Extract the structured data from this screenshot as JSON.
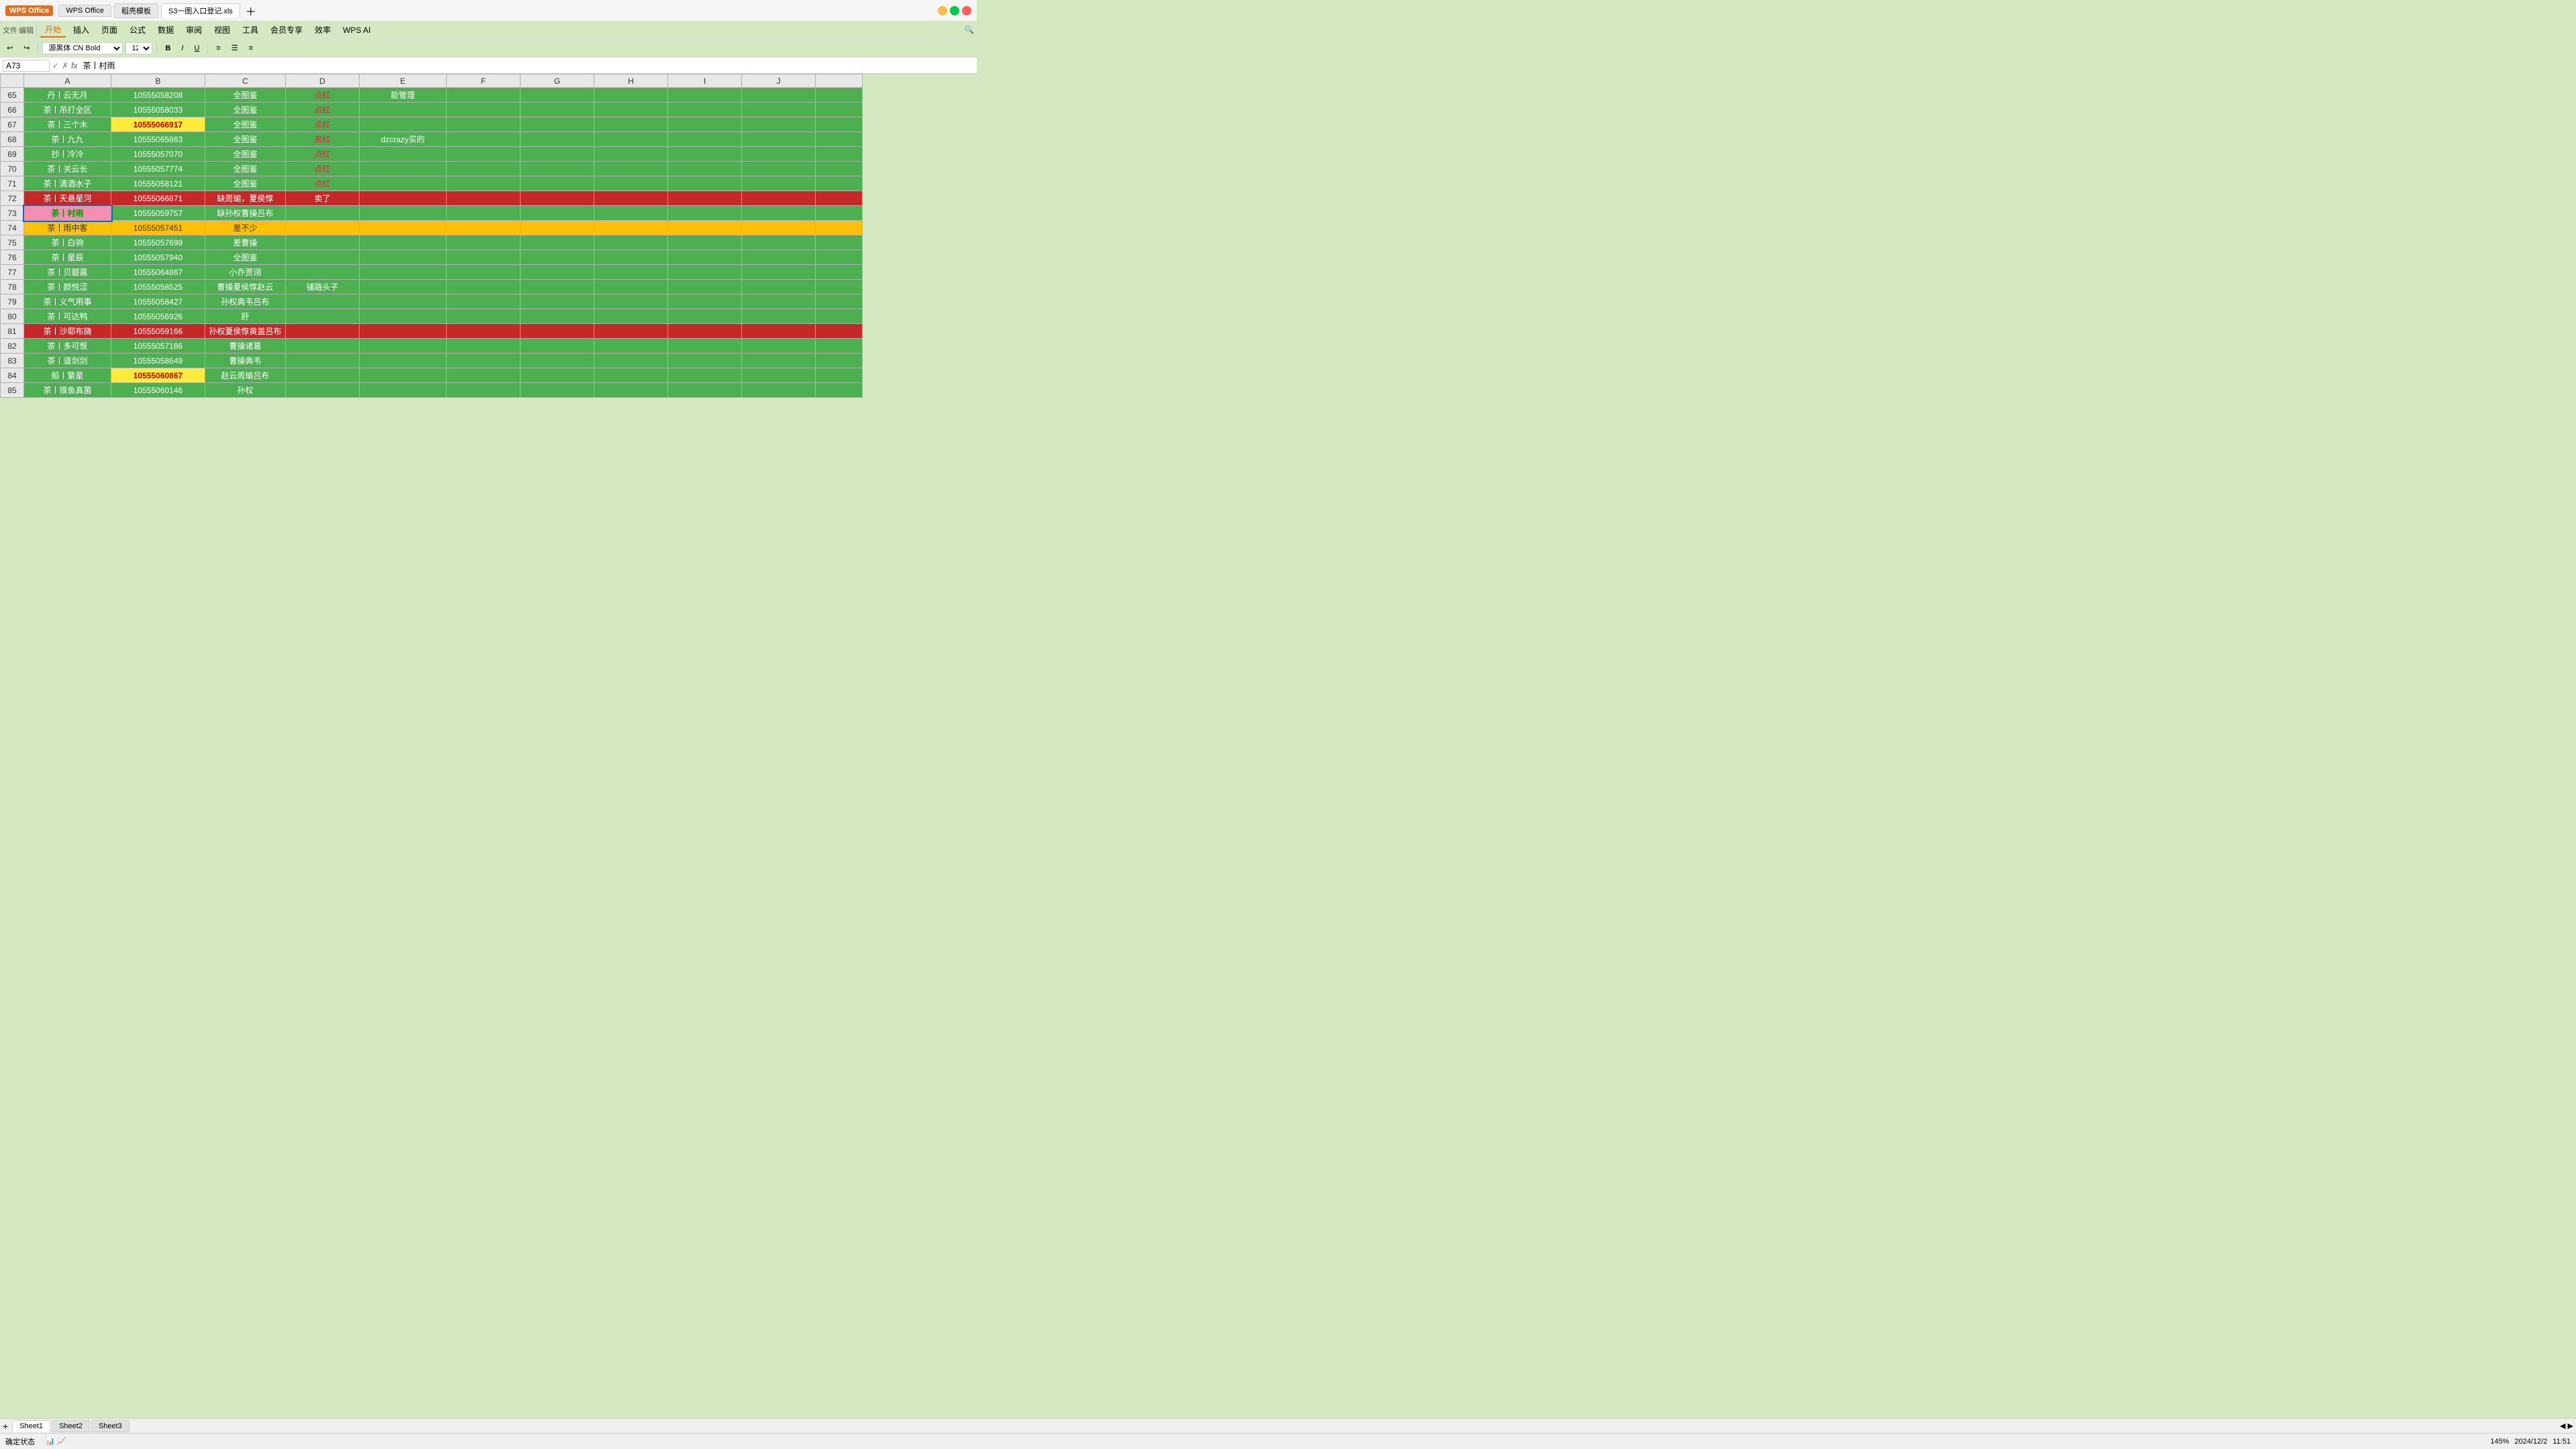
{
  "app": {
    "title": "S3一图入口登记.xls",
    "wps_label": "WPS Office",
    "template_label": "稻壳模板"
  },
  "tabs": [
    {
      "label": "WPS Office",
      "active": false
    },
    {
      "label": "稻壳模板",
      "active": false
    },
    {
      "label": "S3一图入口登记.xls",
      "active": true
    }
  ],
  "menu": {
    "items": [
      "开始",
      "插入",
      "页面",
      "公式",
      "数据",
      "审阅",
      "视图",
      "工具",
      "会员专享",
      "效率",
      "WPS AI"
    ]
  },
  "formula_bar": {
    "cell_ref": "A73",
    "value": "茶丨村雨"
  },
  "columns": {
    "headers": [
      "",
      "A",
      "B",
      "C",
      "D",
      "E",
      "F",
      "G",
      "H",
      "I",
      "J"
    ],
    "widths": [
      35,
      130,
      140,
      120,
      110,
      130,
      110,
      110,
      110,
      110,
      110
    ]
  },
  "rows": [
    {
      "num": 65,
      "color": "green",
      "cells": [
        "丹丨云无月",
        "10555058208",
        "全图鉴",
        "点红",
        "能管理",
        "",
        "",
        "",
        "",
        ""
      ]
    },
    {
      "num": 66,
      "color": "green",
      "cells": [
        "茶丨吊打全区",
        "10555058033",
        "全图鉴",
        "点红",
        "",
        "",
        "",
        "",
        "",
        ""
      ]
    },
    {
      "num": 67,
      "color": "green",
      "cells": [
        "茶丨三个木",
        "10555066917",
        "全图鉴",
        "点红",
        "",
        "",
        "",
        "",
        "",
        ""
      ],
      "cell_b_highlight": "yellow"
    },
    {
      "num": 68,
      "color": "green",
      "cells": [
        "茶丨九九",
        "10555065863",
        "全图鉴",
        "高红",
        "dzcrazy买的",
        "",
        "",
        "",
        "",
        ""
      ]
    },
    {
      "num": 69,
      "color": "green",
      "cells": [
        "抄丨冷冷",
        "10555057070",
        "全图鉴",
        "点红",
        "",
        "",
        "",
        "",
        "",
        ""
      ]
    },
    {
      "num": 70,
      "color": "green",
      "cells": [
        "茶丨关云长",
        "10555057774",
        "全图鉴",
        "点红",
        "",
        "",
        "",
        "",
        "",
        ""
      ]
    },
    {
      "num": 71,
      "color": "green",
      "cells": [
        "茶丨清酒水子",
        "10555058121",
        "全图鉴",
        "点红",
        "",
        "",
        "",
        "",
        "",
        ""
      ]
    },
    {
      "num": 72,
      "color": "red",
      "cells": [
        "茶丨天悬星河",
        "10555066871",
        "缺周瑜，夏侯惇",
        "卖了",
        "",
        "",
        "",
        "",
        "",
        ""
      ]
    },
    {
      "num": 73,
      "color": "green",
      "cells": [
        "茶丨村雨",
        "10555059757",
        "缺孙权曹操吕布",
        "",
        "",
        "",
        "",
        "",
        "",
        ""
      ],
      "cell_a_highlight": "pink",
      "selected": true
    },
    {
      "num": 74,
      "color": "yellow",
      "cells": [
        "茶丨雨中客",
        "10555057451",
        "差不少",
        "",
        "",
        "",
        "",
        "",
        "",
        ""
      ]
    },
    {
      "num": 75,
      "color": "green",
      "cells": [
        "茶丨白驹",
        "10555057699",
        "差曹操",
        "",
        "",
        "",
        "",
        "",
        "",
        ""
      ]
    },
    {
      "num": 76,
      "color": "green",
      "cells": [
        "茶丨星辰",
        "10555057940",
        "全图鉴",
        "",
        "",
        "",
        "",
        "",
        "",
        ""
      ]
    },
    {
      "num": 77,
      "color": "green",
      "cells": [
        "茶丨贝碧嘉",
        "10555064867",
        "小乔贾诩",
        "",
        "",
        "",
        "",
        "",
        "",
        ""
      ]
    },
    {
      "num": 78,
      "color": "green",
      "cells": [
        "茶丨颜悦涩",
        "10555058525",
        "曹操夏侯惇赵云",
        "铺路头子",
        "",
        "",
        "",
        "",
        "",
        ""
      ]
    },
    {
      "num": 79,
      "color": "green",
      "cells": [
        "茶丨义气用事",
        "10555058427",
        "孙权典韦吕布",
        "",
        "",
        "",
        "",
        "",
        "",
        ""
      ]
    },
    {
      "num": 80,
      "color": "green",
      "cells": [
        "茶丨可达鸭",
        "10555056926",
        "肝",
        "",
        "",
        "",
        "",
        "",
        "",
        ""
      ]
    },
    {
      "num": 81,
      "color": "red",
      "cells": [
        "茶丨沙耶布旖",
        "10555059166",
        "孙权夏侯惇黄盖吕布",
        "",
        "",
        "",
        "",
        "",
        "",
        ""
      ]
    },
    {
      "num": 82,
      "color": "green",
      "cells": [
        "茶丨多可恨",
        "10555057186",
        "曹操诸葛",
        "",
        "",
        "",
        "",
        "",
        "",
        ""
      ]
    },
    {
      "num": 83,
      "color": "green",
      "cells": [
        "茶丨道剑剑",
        "10555058649",
        "曹操典韦",
        "",
        "",
        "",
        "",
        "",
        "",
        ""
      ]
    },
    {
      "num": 84,
      "color": "green",
      "cells": [
        "船丨繁星",
        "10555060867",
        "赵云周瑜吕布",
        "",
        "",
        "",
        "",
        "",
        "",
        ""
      ],
      "cell_b_highlight": "yellow"
    },
    {
      "num": 85,
      "color": "green",
      "cells": [
        "茶丨摸鱼真菌",
        "10555060146",
        "孙权",
        "",
        "",
        "",
        "",
        "",
        "",
        ""
      ]
    }
  ],
  "sheet_tabs": [
    "Sheet1",
    "Sheet2",
    "Sheet3"
  ],
  "status": {
    "mode": "确定状态",
    "date": "2024/12/2",
    "time": "11:51",
    "zoom": "145%"
  }
}
